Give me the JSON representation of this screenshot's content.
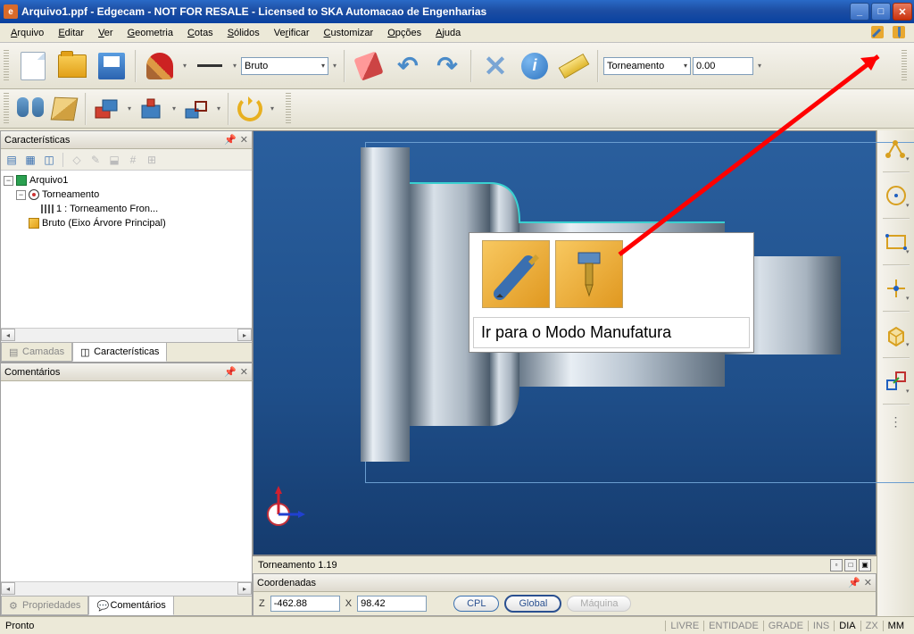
{
  "title": "Arquivo1.ppf - Edgecam - NOT FOR RESALE - Licensed to SKA Automacao de Engenharias",
  "menu": [
    "Arquivo",
    "Editar",
    "Ver",
    "Geometria",
    "Cotas",
    "Sólidos",
    "Verificar",
    "Customizar",
    "Opções",
    "Ajuda"
  ],
  "layer_combo": "Bruto",
  "mode_combo": "Torneamento",
  "mode_value": "0.00",
  "panels": {
    "features": {
      "title": "Características",
      "tree": {
        "root": "Arquivo1",
        "node1": "Torneamento",
        "node1_child": "1 :  Torneamento Fron...",
        "node2": "Bruto (Eixo Árvore Principal)"
      },
      "tabs": {
        "layers": "Camadas",
        "features": "Características"
      }
    },
    "comments": {
      "title": "Comentários",
      "tabs": {
        "props": "Propriedades",
        "comments": "Comentários"
      }
    },
    "coords": {
      "title": "Coordenadas",
      "z_label": "Z",
      "z_val": "-462.88",
      "x_label": "X",
      "x_val": "98.42",
      "btn_cpl": "CPL",
      "btn_global": "Global",
      "btn_machine": "Máquina"
    }
  },
  "viewport_tab": "Torneamento 1.19",
  "tooltip": "Ir para o Modo Manufatura",
  "status": {
    "left": "Pronto",
    "cells": [
      "LIVRE",
      "ENTIDADE",
      "GRADE",
      "INS",
      "DIA",
      "ZX",
      "MM"
    ]
  }
}
